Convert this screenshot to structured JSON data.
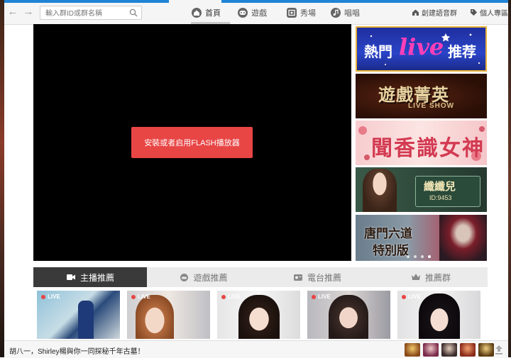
{
  "search": {
    "placeholder": "輸入群ID或群名稱"
  },
  "nav": {
    "tabs": [
      {
        "label": "首頁",
        "icon": "home-icon",
        "active": true
      },
      {
        "label": "遊戲",
        "icon": "gamepad-icon",
        "active": false
      },
      {
        "label": "秀場",
        "icon": "showroom-icon",
        "active": false
      },
      {
        "label": "唱唱",
        "icon": "music-note-icon",
        "active": false
      }
    ],
    "right_links": [
      {
        "label": "創建語音群",
        "icon": "house-icon"
      },
      {
        "label": "個人專區",
        "icon": "tag-icon"
      }
    ]
  },
  "player": {
    "flash_button": "安裝或者启用FLASH播放器"
  },
  "banners": [
    {
      "text_a": "熱門",
      "text_b": "live",
      "text_c": "推荐"
    },
    {
      "text_a": "遊戲菁英",
      "text_b": "LIVE SHOW"
    },
    {
      "text_a": "聞香識女神"
    },
    {
      "text_a": "纖纖兒",
      "text_b": "ID:9453"
    },
    {
      "text_a": "唐門六道",
      "text_b": "特別版"
    }
  ],
  "recommend_tabs": [
    {
      "label": "主播推薦",
      "icon": "broadcaster-icon",
      "active": true
    },
    {
      "label": "遊戲推薦",
      "icon": "game-icon",
      "active": false
    },
    {
      "label": "電台推薦",
      "icon": "radio-icon",
      "active": false
    },
    {
      "label": "推薦群",
      "icon": "crown-icon",
      "active": false
    }
  ],
  "live_label": "LIVE",
  "ticker_text": "胡八一，Shirley楊與你一同探秘千年古墓！",
  "colors": {
    "accent_blue": "#1f84d6",
    "flash_red": "#e84545",
    "active_tab": "#3a3a3a"
  }
}
